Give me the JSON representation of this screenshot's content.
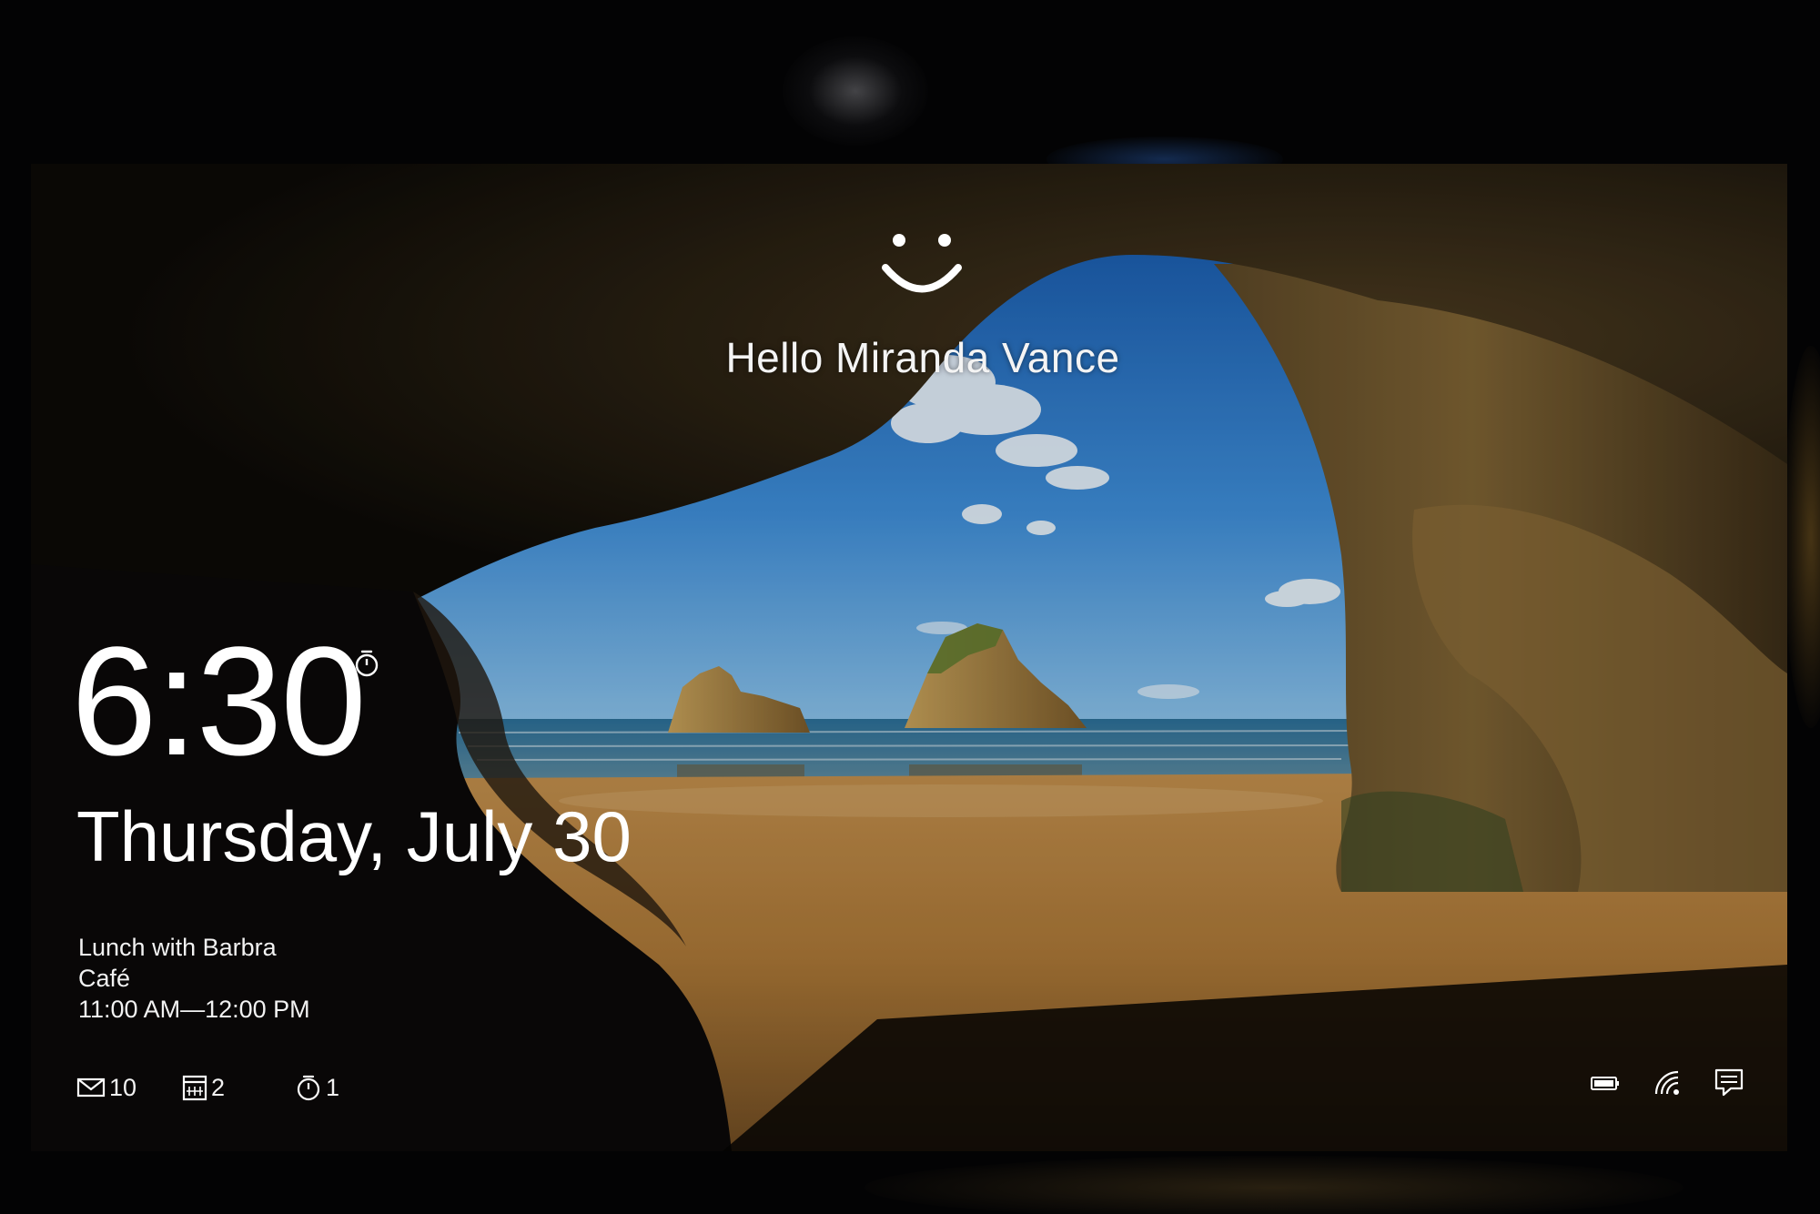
{
  "lock_screen": {
    "greeting": "Hello Miranda Vance",
    "time": "6:30",
    "date": "Thursday, July 30",
    "appointment": {
      "title": "Lunch with Barbra",
      "location": "Café",
      "time_range": "11:00 AM—12:00 PM"
    },
    "badges": [
      {
        "icon": "mail-icon",
        "count": "10"
      },
      {
        "icon": "calendar-icon",
        "count": "2"
      },
      {
        "icon": "alarm-icon",
        "count": "1"
      }
    ],
    "tray_icons": [
      "battery-icon",
      "wifi-icon",
      "notification-icon"
    ]
  },
  "colors": {
    "text": "#ffffff",
    "sky": "#2f7fd0",
    "sand": "#a9773a",
    "rock": "#6b5530"
  }
}
